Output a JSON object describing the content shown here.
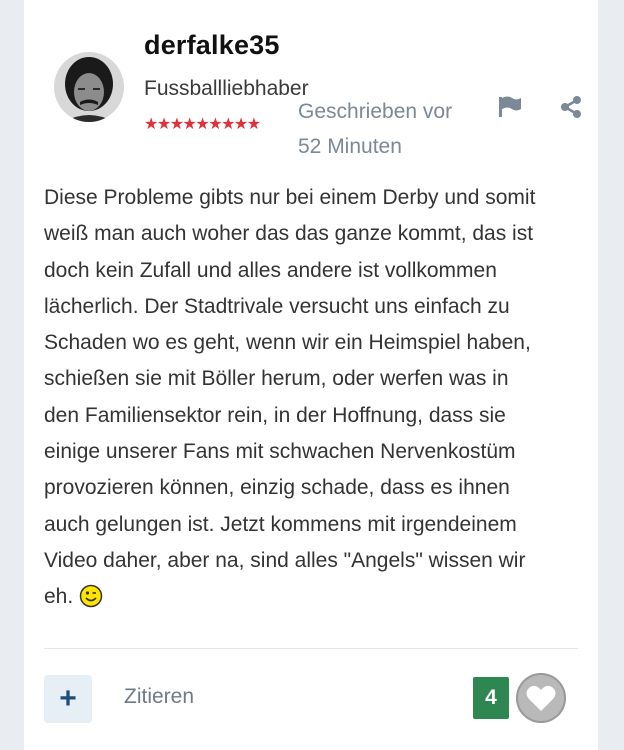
{
  "author": {
    "username": "derfalke35",
    "rank_title": "Fussballliebhaber",
    "rank_stars": "★★★★★★★★★"
  },
  "post": {
    "date_lines": [
      "Geschrieben vor",
      "52 Minuten"
    ],
    "body_lines": [
      "Diese Probleme gibts nur bei einem Derby und somit",
      "weiß man auch woher das das ganze kommt, das ist",
      "doch kein Zufall und alles andere ist vollkommen",
      "lächerlich. Der Stadtrivale versucht uns einfach zu",
      "Schaden wo es geht, wenn wir ein Heimspiel haben,",
      "schießen sie mit Böller herum, oder werfen was in",
      "den Familiensektor rein, in der Hoffnung, dass sie",
      "einige unserer Fans mit schwachen Nervenkostüm",
      "provozieren können, einzig schade, dass es ihnen",
      "auch gelungen ist. Jetzt kommens mit irgendeinem",
      "Video daher, aber na, sind alles \"Angels\" wissen wir",
      "eh."
    ]
  },
  "actions": {
    "plus_label": "+",
    "quote_label": "Zitieren",
    "like_count": "4"
  },
  "icons": {
    "flag": "flag-icon",
    "share": "share-icon",
    "plus": "plus-icon",
    "heart": "heart-icon",
    "emoji": "wink-smiley-icon"
  },
  "colors": {
    "like_count_bg": "#2e8750",
    "stars": "#e0303a",
    "accent": "#1f4e79",
    "muted_text": "#7b8896"
  }
}
